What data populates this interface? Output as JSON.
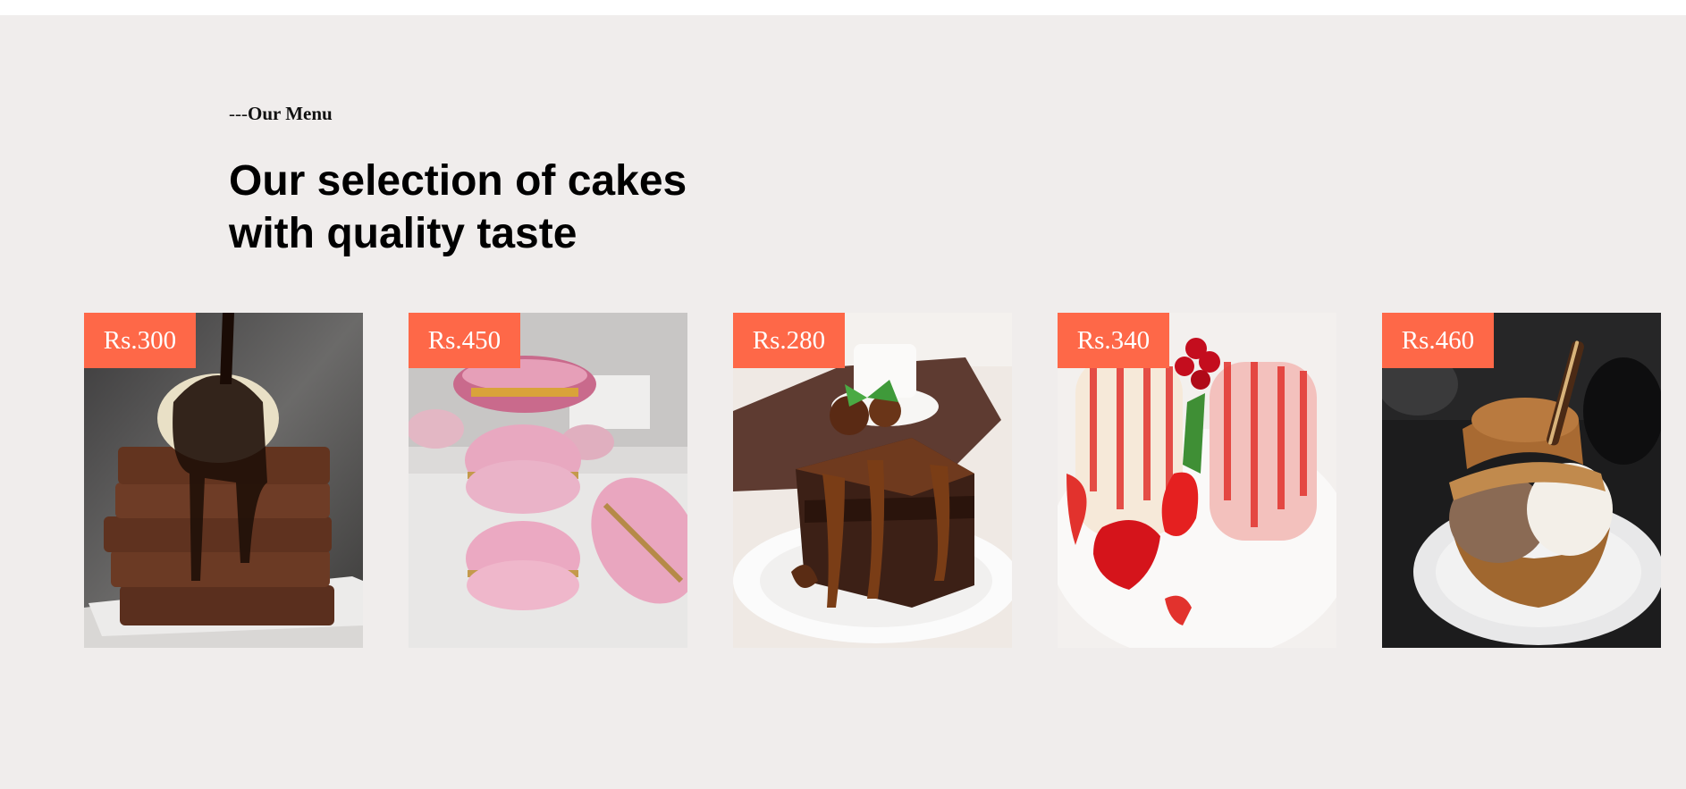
{
  "menu": {
    "eyebrow_dashes": "---",
    "eyebrow_label": "Our Menu",
    "heading_line1": "Our selection of cakes",
    "heading_line2": "with quality taste"
  },
  "cards": [
    {
      "price": "Rs.300",
      "image": "brownie-stack-image"
    },
    {
      "price": "Rs.450",
      "image": "macarons-image"
    },
    {
      "price": "Rs.280",
      "image": "chocolate-cake-slice-image"
    },
    {
      "price": "Rs.340",
      "image": "strawberry-panna-cotta-image"
    },
    {
      "price": "Rs.460",
      "image": "ice-cream-dessert-image"
    }
  ],
  "colors": {
    "background": "#f0edec",
    "price_tag": "#fe6848"
  }
}
